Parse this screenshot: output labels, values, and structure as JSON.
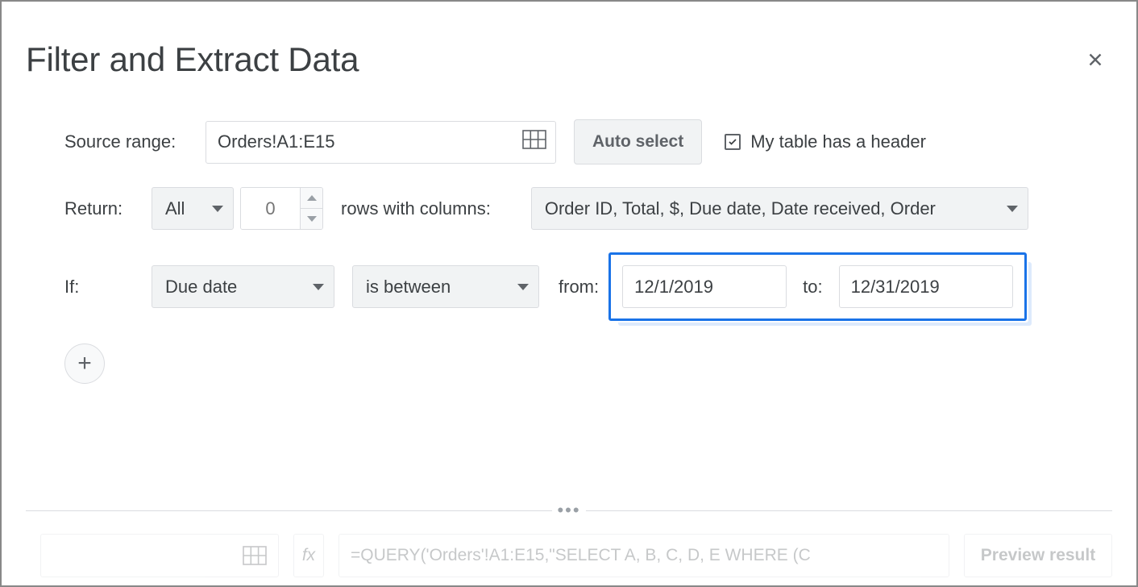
{
  "title": "Filter and Extract Data",
  "source": {
    "label": "Source range:",
    "value": "Orders!A1:E15",
    "autoSelect": "Auto select",
    "headerCheckbox": "My table has a header",
    "headerChecked": true
  },
  "return": {
    "label": "Return:",
    "modeSelected": "All",
    "count": "0",
    "rowsLabel": "rows with columns:",
    "columnsSelected": "Order ID, Total, $, Due date, Date received, Order"
  },
  "condition": {
    "ifLabel": "If:",
    "columnSelected": "Due date",
    "operatorSelected": "is between",
    "fromLabel": "from:",
    "fromValue": "12/1/2019",
    "toLabel": "to:",
    "toValue": "12/31/2019"
  },
  "addIcon": "+",
  "bottom": {
    "fx": "fx",
    "formula": "=QUERY('Orders'!A1:E15,\"SELECT A, B, C, D, E WHERE (C",
    "preview": "Preview result"
  }
}
